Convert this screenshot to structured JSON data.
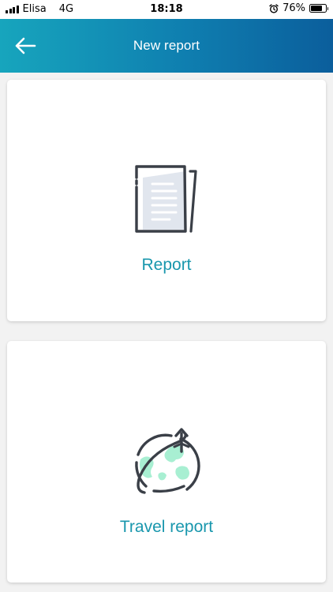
{
  "status_bar": {
    "carrier": "Elisa",
    "network": "4G",
    "time": "18:18",
    "battery_percent": "76%",
    "battery_level": 0.76,
    "icons": [
      "signal-icon",
      "alarm-icon",
      "battery-icon"
    ]
  },
  "header": {
    "title": "New report",
    "back_icon": "arrow-left-icon",
    "gradient": [
      "#17a5bd",
      "#0b5e9c"
    ]
  },
  "options": [
    {
      "label": "Report",
      "icon": "document-icon"
    },
    {
      "label": "Travel report",
      "icon": "globe-plane-icon"
    }
  ],
  "colors": {
    "accent": "#1997ad",
    "icon_stroke": "#3a3f47",
    "paper_fill": "#e1e6ee",
    "map_fill": "#a8efd2",
    "background": "#f2f2f2"
  }
}
